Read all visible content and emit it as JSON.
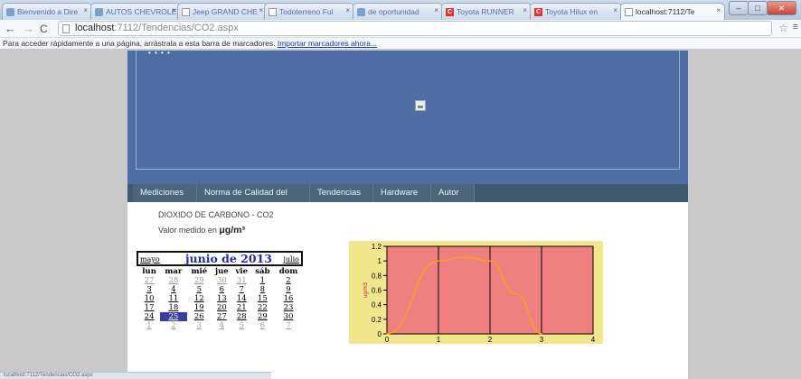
{
  "browser": {
    "tabs": [
      {
        "label": "Bienvenido a Dire",
        "favicon": "ie-icon"
      },
      {
        "label": "AUTOS CHEVROLE",
        "favicon": "chevrolet-icon"
      },
      {
        "label": "Jeep GRAND CHE",
        "favicon": "page-icon"
      },
      {
        "label": "Todoterreno Ful",
        "favicon": "page-icon"
      },
      {
        "label": "de oportunidad",
        "favicon": "site-icon"
      },
      {
        "label": "Toyota RUNNER",
        "favicon": "c-icon"
      },
      {
        "label": "Toyota Hilux en",
        "favicon": "c-icon"
      },
      {
        "label": "localhost:7112/Te",
        "favicon": "page-icon"
      }
    ],
    "url_host": "localhost",
    "url_rest": ":7112/Tendencias/CO2.aspx",
    "bookmarks_text": "Para acceder rápidamente a una página, arrástrala a esta barra de marcadores.",
    "bookmarks_link": "Importar marcadores ahora..."
  },
  "page": {
    "banner_dots": "• • • •",
    "menu": [
      "Mediciones",
      "Norma de Calidad del Aire",
      "Tendencias",
      "Hardware",
      "Autor"
    ],
    "title": "DIOXIDO DE CARBONO - CO2",
    "unit_prefix": "Valor medido en ",
    "unit": "μg/m³"
  },
  "calendar": {
    "prev": "mayo",
    "title": "junio de 2013",
    "next": "julio",
    "weekdays": [
      "lun",
      "mar",
      "mié",
      "jue",
      "vie",
      "sáb",
      "dom"
    ],
    "weeks": [
      [
        "27",
        "28",
        "29",
        "30",
        "31",
        "1",
        "2"
      ],
      [
        "3",
        "4",
        "5",
        "6",
        "7",
        "8",
        "9"
      ],
      [
        "10",
        "11",
        "12",
        "13",
        "14",
        "15",
        "16"
      ],
      [
        "17",
        "18",
        "19",
        "20",
        "21",
        "22",
        "23"
      ],
      [
        "24",
        "25",
        "26",
        "27",
        "28",
        "29",
        "30"
      ],
      [
        "1",
        "2",
        "3",
        "4",
        "5",
        "6",
        "7"
      ]
    ],
    "selected": "25"
  },
  "chart_data": {
    "type": "line",
    "ylabel": "ug/m3",
    "xlim": [
      0,
      4
    ],
    "ylim": [
      0,
      1.2
    ],
    "xticks": [
      "0",
      "1",
      "2",
      "3",
      "4"
    ],
    "yticks": [
      "0",
      "0.2",
      "0.4",
      "0.6",
      "0.8",
      "1",
      "1.2"
    ],
    "x": [
      0,
      1,
      1.5,
      2,
      2.5,
      3
    ],
    "values": [
      0.0,
      1.0,
      1.05,
      1.0,
      0.55,
      0.0
    ],
    "colors": {
      "background": "#f0e68c",
      "plot": "#f08080",
      "line": "#ffa500",
      "grid": "#000000"
    }
  },
  "status": "localhost:7112/Tendencias/CO2.aspx"
}
